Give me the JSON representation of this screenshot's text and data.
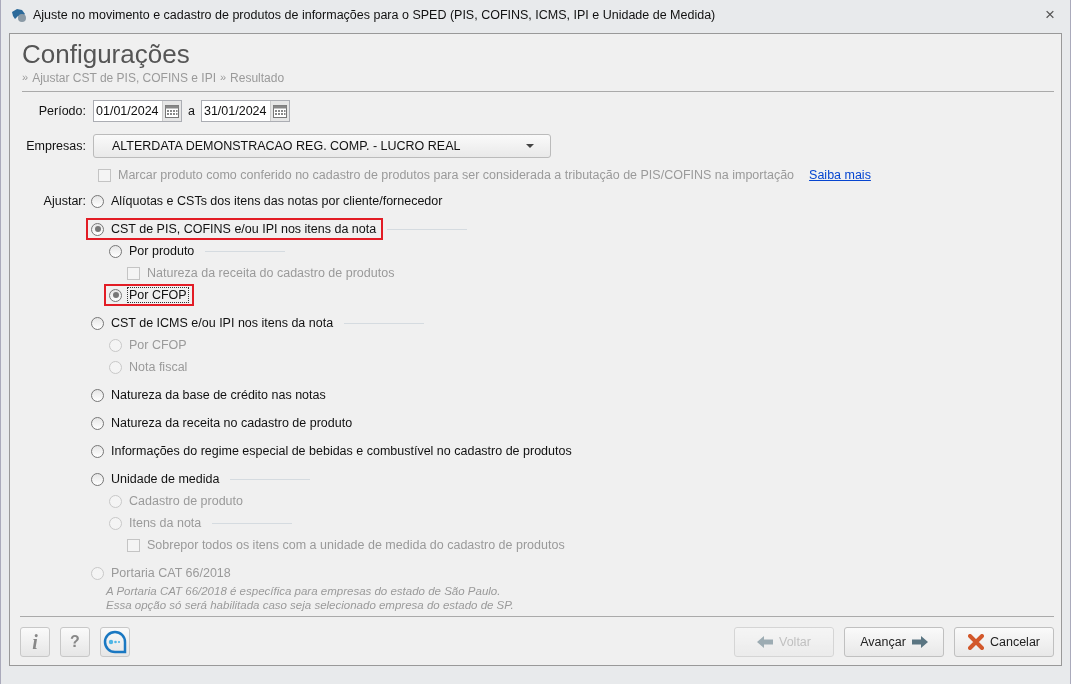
{
  "window": {
    "title": "Ajuste no movimento e cadastro de produtos de informações para o SPED (PIS, COFINS, ICMS, IPI e Unidade de Medida)",
    "close": "×"
  },
  "header": {
    "title": "Configurações",
    "breadcrumb": [
      {
        "sep": "»",
        "label": "Ajustar CST de PIS, COFINS e IPI"
      },
      {
        "sep": "»",
        "label": "Resultado"
      }
    ]
  },
  "period": {
    "label": "Período:",
    "start": "01/01/2024",
    "connector": "a",
    "end": "31/01/2024"
  },
  "company": {
    "label": "Empresas:",
    "value": "ALTERDATA DEMONSTRACAO REG. COMP. - LUCRO REAL"
  },
  "confirm": {
    "label": "Marcar produto como conferido no cadastro de produtos para ser considerada a tributação de PIS/COFINS na importação",
    "checked": false,
    "disabled": true,
    "link": "Saiba mais"
  },
  "adjust": {
    "label": "Ajustar:",
    "options": [
      {
        "kind": "radio",
        "label": "Alíquotas e CSTs dos itens das notas por cliente/fornecedor",
        "selected": false,
        "disabled": false,
        "highlighted": false
      },
      {
        "kind": "radio",
        "label": "CST de PIS, COFINS e/ou IPI nos itens da nota",
        "selected": true,
        "disabled": false,
        "highlighted": true,
        "children": [
          {
            "kind": "radio",
            "label": "Por produto",
            "selected": false,
            "disabled": false,
            "highlighted": false,
            "children": [
              {
                "kind": "checkbox",
                "label": "Natureza da receita do cadastro de produtos",
                "checked": false,
                "disabled": true,
                "highlighted": false
              }
            ]
          },
          {
            "kind": "radio",
            "label": "Por CFOP",
            "selected": true,
            "disabled": false,
            "highlighted": true,
            "focused": true
          }
        ]
      },
      {
        "kind": "radio",
        "label": "CST de ICMS e/ou IPI nos itens da nota",
        "selected": false,
        "disabled": false,
        "highlighted": false,
        "children": [
          {
            "kind": "radio",
            "label": "Por CFOP",
            "selected": false,
            "disabled": true,
            "highlighted": false
          },
          {
            "kind": "radio",
            "label": "Nota fiscal",
            "selected": false,
            "disabled": true,
            "highlighted": false
          }
        ]
      },
      {
        "kind": "radio",
        "label": "Natureza da base de crédito nas notas",
        "selected": false,
        "disabled": false,
        "highlighted": false
      },
      {
        "kind": "radio",
        "label": "Natureza da receita no cadastro de produto",
        "selected": false,
        "disabled": false,
        "highlighted": false
      },
      {
        "kind": "radio",
        "label": "Informações do regime especial de bebidas e combustível no cadastro de produtos",
        "selected": false,
        "disabled": false,
        "highlighted": false
      },
      {
        "kind": "radio",
        "label": "Unidade de medida",
        "selected": false,
        "disabled": false,
        "highlighted": false,
        "children": [
          {
            "kind": "radio",
            "label": "Cadastro de produto",
            "selected": false,
            "disabled": true,
            "highlighted": false
          },
          {
            "kind": "radio",
            "label": "Itens da nota",
            "selected": false,
            "disabled": true,
            "highlighted": false,
            "children": [
              {
                "kind": "checkbox",
                "label": "Sobrepor todos os itens com a unidade de medida do cadastro de produtos",
                "checked": false,
                "disabled": true,
                "highlighted": false
              }
            ]
          }
        ]
      },
      {
        "kind": "radio",
        "label": "Portaria CAT 66/2018",
        "selected": false,
        "disabled": true,
        "highlighted": false,
        "note": [
          "A Portaria CAT 66/2018 é específica para empresas do estado de São Paulo.",
          "Essa opção só será habilitada caso seja selecionado empresa do estado de SP."
        ]
      }
    ]
  },
  "footer": {
    "left_buttons": [
      {
        "kind": "info",
        "label": "i"
      },
      {
        "kind": "help",
        "label": "?"
      },
      {
        "kind": "chat"
      }
    ],
    "right_buttons": [
      {
        "kind": "back",
        "label": "Voltar",
        "disabled": true
      },
      {
        "kind": "next",
        "label": "Avançar",
        "disabled": false
      },
      {
        "kind": "cancel",
        "label": "Cancelar",
        "disabled": false
      }
    ]
  }
}
